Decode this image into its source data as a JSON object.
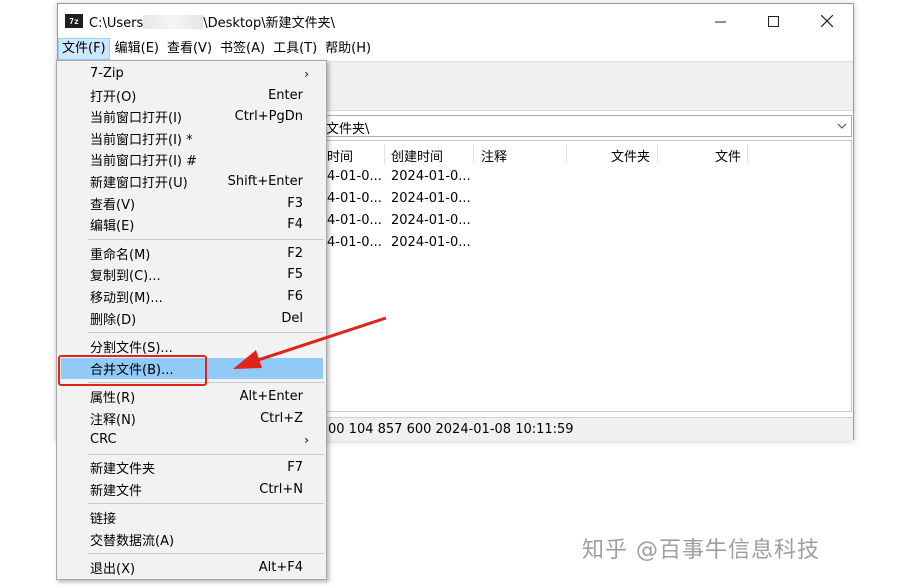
{
  "window": {
    "title_prefix": "C:\\Users",
    "title_suffix": "\\Desktop\\新建文件夹\\",
    "app_icon": "7z"
  },
  "menubar": [
    "文件(F)",
    "编辑(E)",
    "查看(V)",
    "书签(A)",
    "工具(T)",
    "帮助(H)"
  ],
  "address": {
    "visible_text": "文件夹\\"
  },
  "filelist": {
    "columns": [
      "时间",
      "创建时间",
      "注释",
      "文件夹",
      "文件"
    ],
    "rows": [
      {
        "modified": "4-01-0...",
        "created": "2024-01-0..."
      },
      {
        "modified": "4-01-0...",
        "created": "2024-01-0..."
      },
      {
        "modified": "4-01-0...",
        "created": "2024-01-0..."
      },
      {
        "modified": "4-01-0...",
        "created": "2024-01-0..."
      }
    ]
  },
  "status": {
    "text": "00  104 857 600  2024-01-08 10:11:59"
  },
  "file_menu": {
    "groups": [
      [
        {
          "label": "7-Zip",
          "shortcut": "",
          "submenu": true
        },
        {
          "label": "打开(O)",
          "shortcut": "Enter"
        },
        {
          "label": "当前窗口打开(I)",
          "shortcut": "Ctrl+PgDn"
        },
        {
          "label": "当前窗口打开(I) *",
          "shortcut": ""
        },
        {
          "label": "当前窗口打开(I) #",
          "shortcut": ""
        },
        {
          "label": "新建窗口打开(U)",
          "shortcut": "Shift+Enter"
        },
        {
          "label": "查看(V)",
          "shortcut": "F3"
        },
        {
          "label": "编辑(E)",
          "shortcut": "F4"
        }
      ],
      [
        {
          "label": "重命名(M)",
          "shortcut": "F2"
        },
        {
          "label": "复制到(C)...",
          "shortcut": "F5"
        },
        {
          "label": "移动到(M)...",
          "shortcut": "F6"
        },
        {
          "label": "删除(D)",
          "shortcut": "Del"
        }
      ],
      [
        {
          "label": "分割文件(S)...",
          "shortcut": ""
        },
        {
          "label": "合并文件(B)...",
          "shortcut": "",
          "highlighted": true
        }
      ],
      [
        {
          "label": "属性(R)",
          "shortcut": "Alt+Enter"
        },
        {
          "label": "注释(N)",
          "shortcut": "Ctrl+Z"
        },
        {
          "label": "CRC",
          "shortcut": "",
          "submenu": true
        }
      ],
      [
        {
          "label": "新建文件夹",
          "shortcut": "F7"
        },
        {
          "label": "新建文件",
          "shortcut": "Ctrl+N"
        }
      ],
      [
        {
          "label": "链接",
          "shortcut": ""
        },
        {
          "label": "交替数据流(A)",
          "shortcut": ""
        }
      ],
      [
        {
          "label": "退出(X)",
          "shortcut": "Alt+F4"
        }
      ]
    ]
  },
  "annotation_color": "#e0241b",
  "watermark": "知乎 @百事牛信息科技"
}
